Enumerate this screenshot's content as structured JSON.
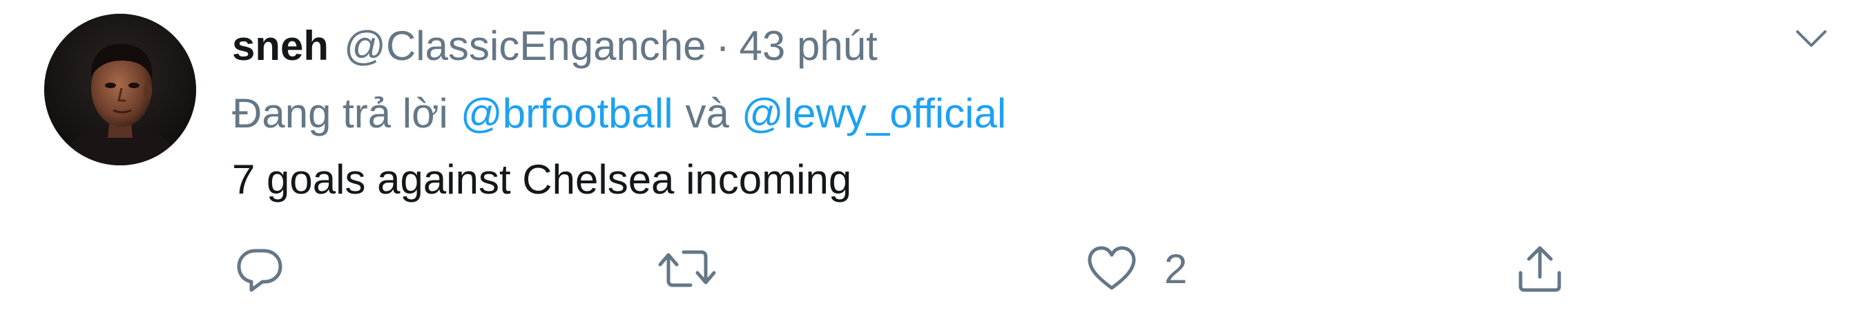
{
  "tweet": {
    "author": {
      "display_name": "sneh",
      "handle": "@ClassicEnganche"
    },
    "separator": "·",
    "timestamp": "43 phút",
    "reply_context": {
      "prefix": "Đang trả lời",
      "mentions": [
        "@brfootball",
        "@lewy_official"
      ],
      "conjunction": "và"
    },
    "text": "7 goals against Chelsea incoming",
    "actions": {
      "reply": {
        "icon": "reply-icon",
        "count": ""
      },
      "retweet": {
        "icon": "retweet-icon",
        "count": ""
      },
      "like": {
        "icon": "heart-icon",
        "count": "2"
      },
      "share": {
        "icon": "share-icon"
      }
    },
    "menu_icon": "chevron-down-icon"
  },
  "colors": {
    "text_primary": "#14171a",
    "text_secondary": "#657786",
    "link": "#1da1f2",
    "background": "#ffffff"
  }
}
